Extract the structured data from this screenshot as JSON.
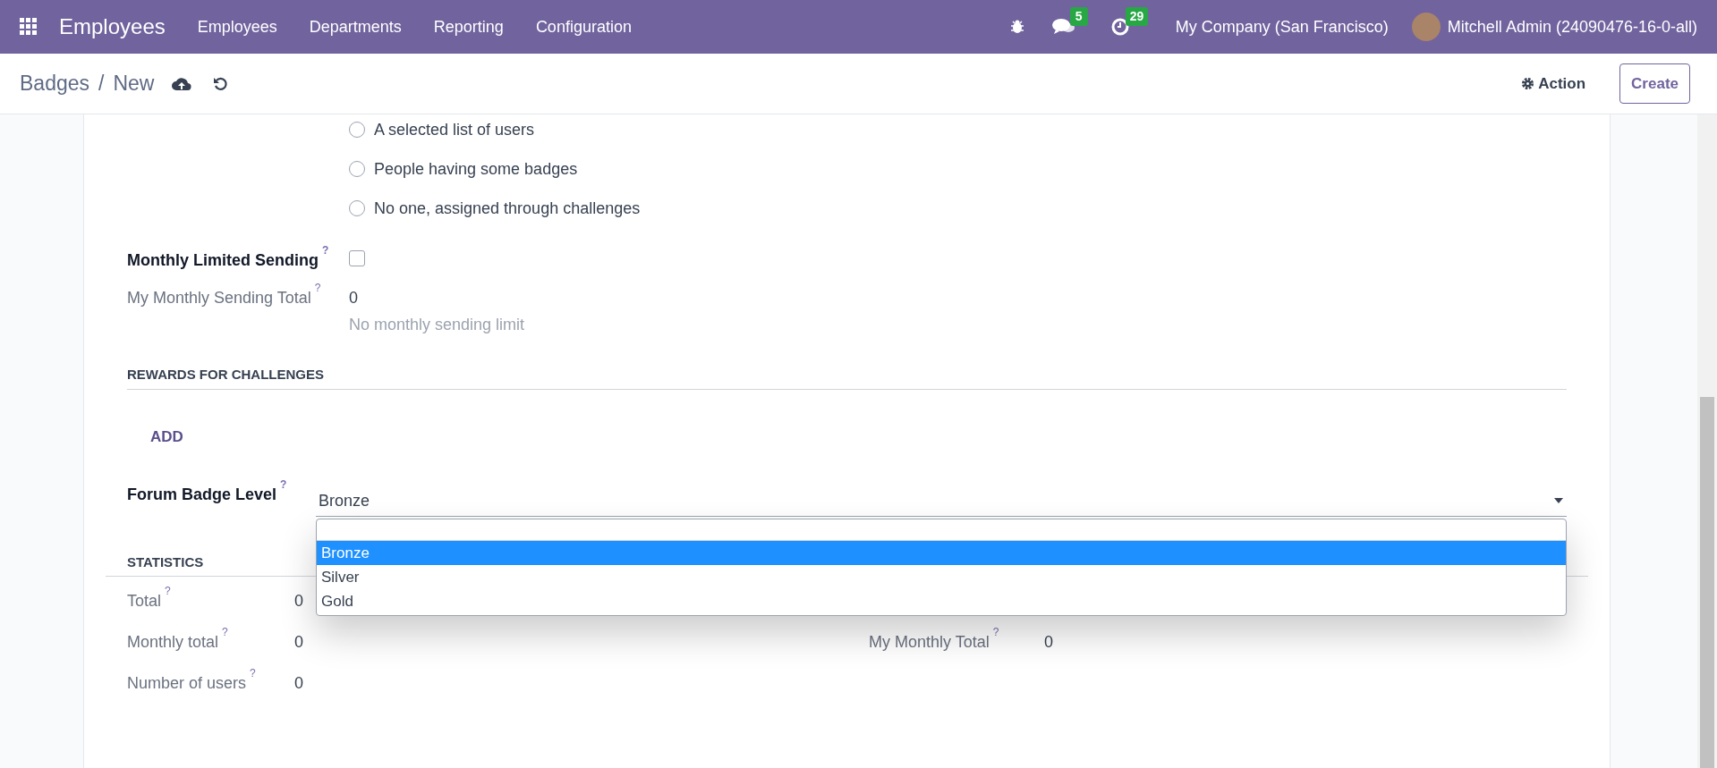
{
  "navbar": {
    "app_name": "Employees",
    "menu": [
      "Employees",
      "Departments",
      "Reporting",
      "Configuration"
    ],
    "messages_count": "5",
    "activities_count": "29",
    "company": "My Company (San Francisco)",
    "user": "Mitchell Admin (24090476-16-0-all)"
  },
  "control_panel": {
    "breadcrumb": [
      "Badges",
      "New"
    ],
    "separator": "/",
    "action": "Action",
    "create": "Create"
  },
  "form": {
    "assign_options": [
      {
        "label": "A selected list of users",
        "selected": false
      },
      {
        "label": "People having some badges",
        "selected": false
      },
      {
        "label": "No one, assigned through challenges",
        "selected": false
      }
    ],
    "monthly_limited": {
      "label": "Monthly Limited Sending",
      "help": "?",
      "checked": false
    },
    "monthly_total": {
      "label": "My Monthly Sending Total",
      "help": "?",
      "value": "0",
      "note": "No monthly sending limit"
    },
    "rewards": {
      "heading": "REWARDS FOR CHALLENGES",
      "add": "ADD"
    },
    "forum_badge_level": {
      "label": "Forum Badge Level",
      "help": "?",
      "value": "Bronze",
      "options": [
        {
          "label": "Bronze",
          "selected": true
        },
        {
          "label": "Silver",
          "selected": false
        },
        {
          "label": "Gold",
          "selected": false
        }
      ]
    },
    "statistics": {
      "heading": "STATISTICS",
      "left": [
        {
          "label": "Total",
          "help": "?",
          "value": "0"
        },
        {
          "label": "Monthly total",
          "help": "?",
          "value": "0"
        },
        {
          "label": "Number of users",
          "help": "?",
          "value": "0"
        }
      ],
      "right": [
        {
          "label": "My Monthly Total",
          "help": "?",
          "value": "0"
        }
      ]
    }
  }
}
